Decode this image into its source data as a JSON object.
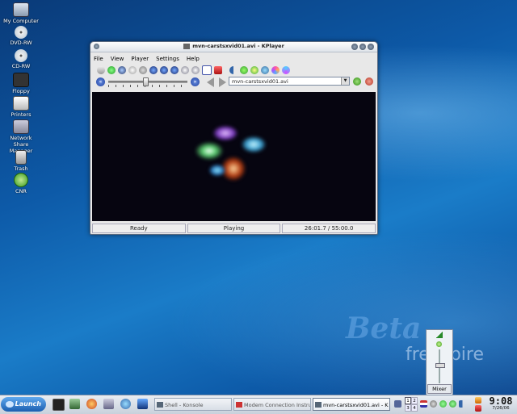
{
  "desktop": {
    "icons": [
      {
        "label": "My Computer",
        "icon": "computer-icon"
      },
      {
        "label": "DVD-RW",
        "icon": "dvd-icon"
      },
      {
        "label": "CD-RW",
        "icon": "cd-icon"
      },
      {
        "label": "Floppy",
        "icon": "floppy-icon"
      },
      {
        "label": "Printers",
        "icon": "printer-icon"
      },
      {
        "label": "Network Share Manager",
        "icon": "network-icon"
      },
      {
        "label": "Trash",
        "icon": "trash-icon"
      },
      {
        "label": "CNR",
        "icon": "cnr-icon"
      }
    ],
    "watermark_beta": "Beta",
    "watermark_brand": "freespire"
  },
  "window": {
    "title": "mvn-carstsxvid01.avi - KPlayer",
    "menu": [
      "File",
      "View",
      "Player",
      "Settings",
      "Help"
    ],
    "url_value": "mvn-carstsxvid01.avi",
    "seek_position": 0.47,
    "status": {
      "state": "Ready",
      "playback": "Playing",
      "time": "26:01.7 / 55:00.0"
    }
  },
  "mixer": {
    "button_label": "Mixer",
    "volume_level": 0.55
  },
  "taskbar": {
    "launch_label": "Launch",
    "tasks": [
      {
        "label": "Shell - Konsole",
        "active": false
      },
      {
        "label": "Modem Connection Instru",
        "active": false
      },
      {
        "label": "mvn-carstsxvid01.avi - K",
        "active": true
      }
    ],
    "pager": [
      "1",
      "2",
      "3",
      "4"
    ],
    "clock_time": "9:08",
    "clock_date": "7/26/06"
  },
  "colors": {
    "accent": "#1b5fb0",
    "desktop": "#0d5aa8"
  }
}
